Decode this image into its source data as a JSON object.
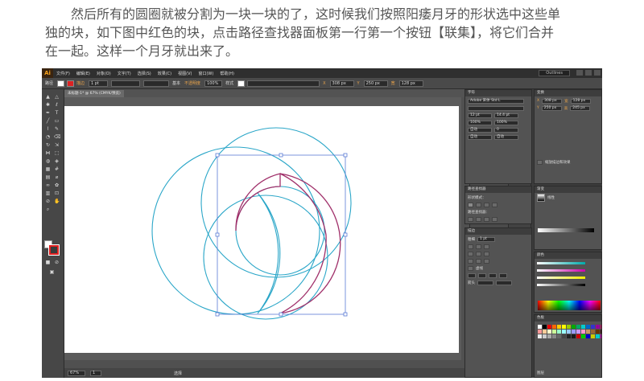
{
  "intro": {
    "line1": "然后所有的圆圈就被分割为一块一块的了，这时候我们按照阳痿月牙的形状选中这些单",
    "line2": "独的块，如下图中红色的块，点击路径查找器面板第一行第一个按钮【联集】，将它们合并",
    "line3": "在一起。这样一个月牙就出来了。"
  },
  "app": {
    "logo": "Ai",
    "menu": [
      "文件(F)",
      "编辑(E)",
      "对象(O)",
      "文字(T)",
      "选择(S)",
      "效果(C)",
      "视图(V)",
      "窗口(W)",
      "帮助(H)"
    ],
    "workspace": "Outlines",
    "control": {
      "label": "路径",
      "stroke_label": "描边",
      "stroke_value": "1 pt",
      "brush_label": "基本",
      "opacity_label": "不透明度",
      "opacity_value": "100%",
      "style_label": "样式",
      "x_label": "X",
      "x_value": "308 px",
      "y_label": "Y",
      "y_value": "250 px",
      "w_label": "宽",
      "w_value": "128 px"
    },
    "doc_tab": "未标题-1* @ 67% (CMYK/预览)",
    "status": {
      "zoom": "67%",
      "page": "1",
      "tool": "选择"
    },
    "panels": {
      "char_title": "字符",
      "char_font": "Adobe 宋体 Std L",
      "char_size": "12 pt",
      "char_leading": "14.4 pt",
      "char_scale": "100%",
      "char_track": "0",
      "char_auto": "自动",
      "transform_title": "变换",
      "transform_x": "308 px",
      "transform_y": "250 px",
      "transform_w": "128 px",
      "transform_h": "245 px",
      "transform_note": "缩放描边和效果",
      "gradient_title": "渐变",
      "gradient_type": "线性",
      "pathfinder_title": "路径查找器",
      "shape_modes": "形状模式：",
      "pathfinders": "路径查找器：",
      "stroke_title": "描边",
      "stroke_weight_label": "粗细",
      "stroke_weight": "1 pt",
      "dashed": "虚线",
      "arrow_label": "箭头",
      "color_title": "颜色",
      "swatches_title": "色板",
      "layers": "图层"
    }
  },
  "colors": {
    "blue_path": "#2aa6c8",
    "red_path": "#a0306a",
    "selection": "#5b7bd5"
  }
}
